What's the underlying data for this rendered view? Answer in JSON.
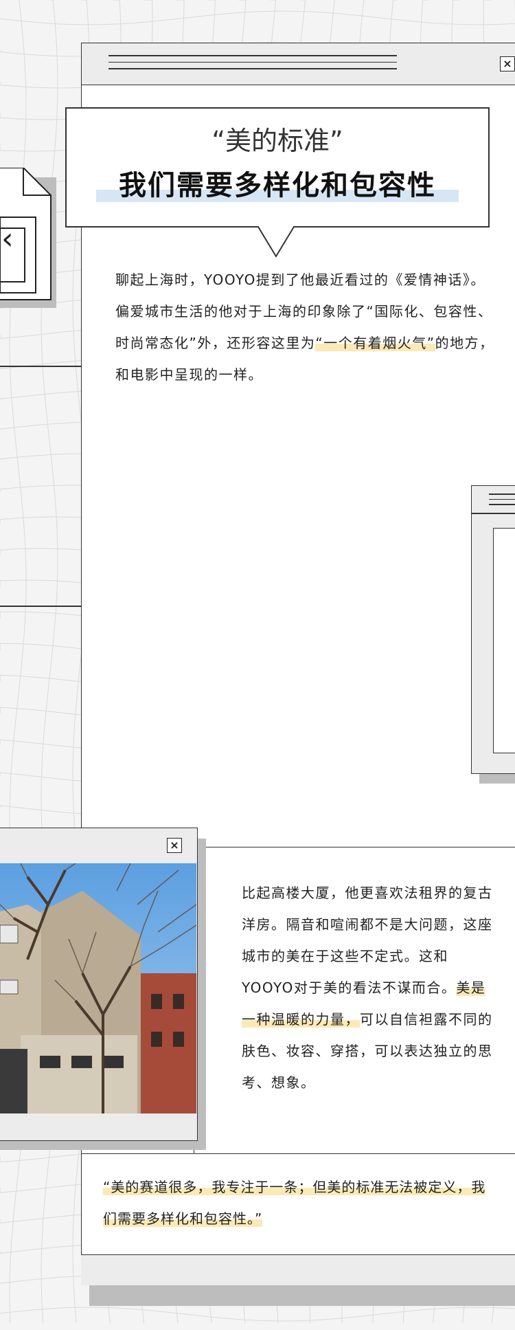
{
  "heading": {
    "quote_title": "“美的标准”",
    "main_title": "我们需要多样化和包容性"
  },
  "article": {
    "p1_a": "聊起上海时，YOOYO提到了他最近看过的《爱情神话》。偏爱城市生活的他对于上海的印象除了“国际化、包容性、时尚常态化”外，还形容这里为",
    "p1_highlight": "“一个有着烟火气”",
    "p1_b": "的地方，和电影中呈现的一样。",
    "p2_a": "比起高楼大厦，他更喜欢法租界的复古洋房。隔音和喧闹都不是大问题，这座城市的美在于这些不定式。这和YOOYO对于美的看法不谋而合。",
    "p2_highlight": "美是一种温暖的力量，",
    "p2_b": "可以自信袒露不同的肤色、妆容、穿搭，可以表达独立的思考、想象。"
  },
  "quote": {
    "text": "“美的赛道很多，我专注于一条；但美的标准无法被定义，我们需要多样化和包容性。”"
  },
  "icons": {
    "close": "×",
    "back_chevron": "‹"
  },
  "colors": {
    "highlight": "#fbe9b6",
    "title_underline": "#d7e6f4",
    "border": "#333333",
    "shadow": "#bdbdbd",
    "chrome": "#ececec"
  }
}
